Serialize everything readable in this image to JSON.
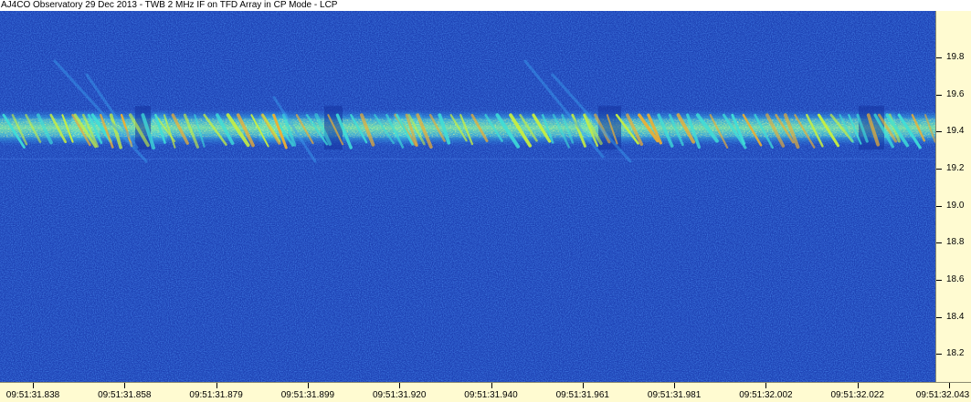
{
  "title": "AJ4CO Observatory 29 Dec 2013 - TWB 2 MHz IF on TFD Array in CP Mode - LCP",
  "chart_data": {
    "type": "heatmap",
    "title": "AJ4CO Observatory 29 Dec 2013 - TWB 2 MHz IF on TFD Array in CP Mode - LCP",
    "xlabel": "",
    "ylabel": "",
    "x_tick_labels": [
      "09:51:31.838",
      "09:51:31.858",
      "09:51:31.879",
      "09:51:31.899",
      "09:51:31.920",
      "09:51:31.940",
      "09:51:31.961",
      "09:51:31.981",
      "09:51:32.002",
      "09:51:32.022",
      "09:51:32.043"
    ],
    "y_tick_labels": [
      "19.8",
      "19.6",
      "19.4",
      "19.2",
      "19.0",
      "18.8",
      "18.6",
      "18.4",
      "18.2"
    ],
    "y_ticks": [
      19.8,
      19.6,
      19.4,
      19.2,
      19.0,
      18.8,
      18.6,
      18.4,
      18.2
    ],
    "ylim": [
      18.05,
      20.05
    ],
    "y_axis_side": "right",
    "colormap": [
      "#0a1c8c",
      "#1d43c4",
      "#2e7fe0",
      "#3fd0e0",
      "#c8f03a",
      "#f4a21f"
    ],
    "background_color": "#1a3fb0",
    "emission_band": {
      "center": 19.42,
      "segments": [
        {
          "start": "09:51:31.838",
          "end": "09:51:31.853"
        },
        {
          "start": "09:51:31.854",
          "end": "09:51:31.868"
        },
        {
          "start": "09:51:31.872",
          "end": "09:51:31.895"
        },
        {
          "start": "09:51:31.896",
          "end": "09:51:31.925"
        },
        {
          "start": "09:51:31.926",
          "end": "09:51:31.963"
        },
        {
          "start": "09:51:31.968",
          "end": "09:51:32.031"
        },
        {
          "start": "09:51:32.033",
          "end": "09:51:32.043"
        }
      ]
    },
    "grid": false,
    "legend": "none"
  }
}
